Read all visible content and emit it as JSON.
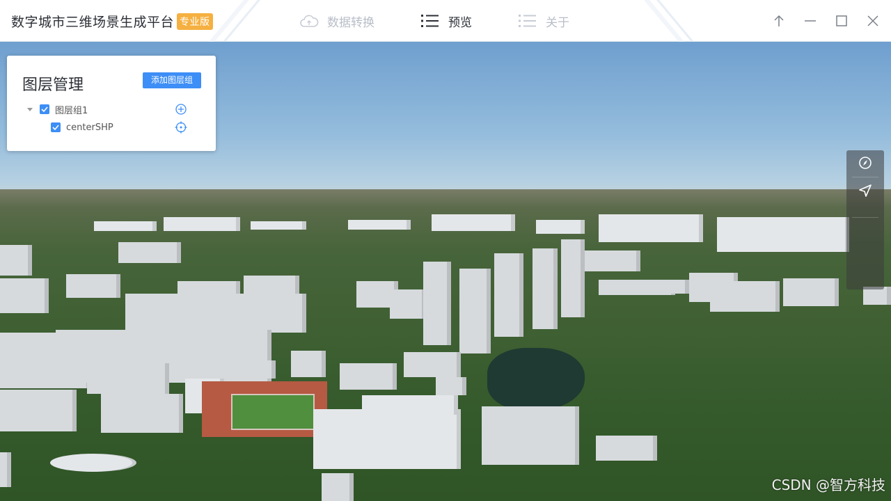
{
  "app": {
    "title": "数字城市三维场景生成平台",
    "edition_badge": "专业版"
  },
  "nav": {
    "items": [
      {
        "label": "数据转换",
        "icon": "cloud-icon",
        "active": false
      },
      {
        "label": "预览",
        "icon": "list-icon",
        "active": true
      },
      {
        "label": "关于",
        "icon": "list-icon",
        "active": false
      }
    ]
  },
  "window_controls": {
    "icons": [
      "arrow-up-icon",
      "minimize-icon",
      "maximize-icon",
      "close-icon"
    ]
  },
  "layer_panel": {
    "title": "图层管理",
    "add_group_label": "添加图层组",
    "tree": [
      {
        "label": "图层组1",
        "checked": true,
        "expanded": true,
        "action_icon": "plus-circle-icon",
        "children": [
          {
            "label": "centerSHP",
            "checked": true,
            "action_icon": "locate-icon"
          }
        ]
      }
    ]
  },
  "map_toolbar": {
    "tools": [
      "compass-icon",
      "navigate-icon"
    ]
  },
  "watermark": "CSDN @智方科技",
  "colors": {
    "accent": "#3d8ef6",
    "badge": "#f5b041",
    "text": "#2b2f36",
    "nav_inactive": "#b8bec8"
  }
}
